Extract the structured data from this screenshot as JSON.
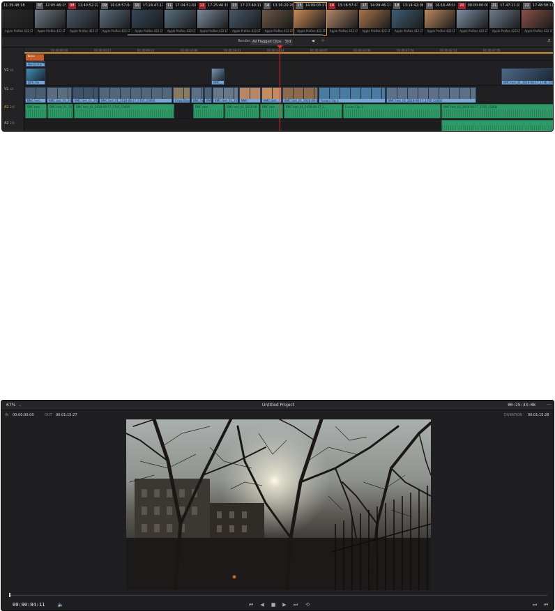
{
  "strip": {
    "clips": [
      {
        "num": "",
        "tc": "11:39:48:18",
        "cap": "Apple ProRes 422 LT",
        "color": "#2a2a2a"
      },
      {
        "num": "07",
        "tc": "12:05:46:15",
        "cap": "Apple ProRes 422 LT",
        "color": "#6e7a86"
      },
      {
        "num": "08",
        "tc": "11:40:52:22",
        "cap": "Apple ProRes 422 LT",
        "color": "#4a5868"
      },
      {
        "num": "09",
        "tc": "16:18:57:04",
        "cap": "Apple ProRes 422 LT",
        "color": "#5c6e7e"
      },
      {
        "num": "10",
        "tc": "17:24:47:17",
        "cap": "Apple ProRes 422 LT",
        "color": "#34465a"
      },
      {
        "num": "11",
        "tc": "17:24:51:02",
        "cap": "Apple ProRes 422 LT",
        "color": "#59707e"
      },
      {
        "num": "12",
        "tc": "17:25:46:19",
        "cap": "Apple ProRes 422 LT",
        "color": "#7b8c9c"
      },
      {
        "num": "13",
        "tc": "17:27:49:11",
        "cap": "Apple ProRes 422 LT",
        "color": "#475a6b"
      },
      {
        "num": "14",
        "tc": "13:16:20:20",
        "cap": "Apple ProRes 422 LT",
        "color": "#6b5745"
      },
      {
        "num": "15",
        "tc": "14:09:03:17",
        "cap": "Apple ProRes 422 LT",
        "color": "#c98a55"
      },
      {
        "num": "16",
        "tc": "13:16:57:07",
        "cap": "Apple ProRes 422 LT",
        "color": "#b2876a"
      },
      {
        "num": "17",
        "tc": "14:09:46:11",
        "cap": "Apple ProRes 422 LT",
        "color": "#a9744c"
      },
      {
        "num": "18",
        "tc": "13:14:42:06",
        "cap": "Apple ProRes 422 LT",
        "color": "#3d5f76"
      },
      {
        "num": "19",
        "tc": "16:16:48:16",
        "cap": "Apple ProRes 422 LT",
        "color": "#bd8a60"
      },
      {
        "num": "20",
        "tc": "00:00:00:00",
        "cap": "Apple ProRes 422 LT",
        "color": "#7d8fa5"
      },
      {
        "num": "21",
        "tc": "17:47:11:13",
        "cap": "Apple ProRes 422 LT",
        "color": "#6e7b8a"
      },
      {
        "num": "22",
        "tc": "17:48:58:11",
        "cap": "Apple ProRes 422 LT",
        "color": "#8a5048"
      }
    ]
  },
  "toolbar": {
    "render": "Render",
    "clips_select": "All Flagged Clips",
    "mode": "Std"
  },
  "ruler": {
    "ticks": [
      "01:00:00:00",
      "01:00:04:17",
      "01:00:09:12",
      "01:00:14:00",
      "01:00:18:21",
      "01:00:23:14",
      "01:00:28:07",
      "01:00:33:00",
      "01:00:37:16",
      "01:00:42:12",
      "01:00:47:05"
    ]
  },
  "tracks": {
    "v2": {
      "label": "V2"
    },
    "v1": {
      "label": "V1"
    },
    "a1": {
      "label": "A1",
      "level": "2.0"
    },
    "a2": {
      "label": "A2",
      "level": "2.0"
    },
    "title_clip": "Text+",
    "v2_clips": [
      {
        "label": "Horizontal Title"
      },
      {
        "label": "DPX_file"
      },
      {
        "label": "BMC_..."
      },
      {
        "label": "BMC test_01_2018-08-17_1746_C0001"
      }
    ],
    "v1_clips": [
      {
        "label": "BMC test...",
        "color": "#4a5d72"
      },
      {
        "label": "BMC test_01_2018...",
        "color": "#5a6e80"
      },
      {
        "label": "BMC test_01_201...",
        "color": "#3e5268"
      },
      {
        "label": "BMC test_01_2018-08-17_1745_C0000",
        "color": "#53677b"
      },
      {
        "label": "Cross Dissolve",
        "color": "#8a7a60"
      },
      {
        "label": "BMC test...",
        "color": "#5d6f82"
      },
      {
        "label": "BMC",
        "color": "#4e6276"
      },
      {
        "label": "BMC test_01_2018-08-...",
        "color": "#66788a"
      },
      {
        "label": "BMC",
        "color": "#b68762"
      },
      {
        "label": "BMC test...",
        "color": "#c28c5e"
      },
      {
        "label": "BMC test_01_2018-08-17_1...",
        "color": "#8e6a4c"
      },
      {
        "label": "Fusion Clip 1",
        "color": "#4a7aa0"
      },
      {
        "label": "BMC test_01_2018-08-17_1745_C0002",
        "color": "#5e7088"
      }
    ],
    "a1_clips": [
      {
        "label": "BMC test..."
      },
      {
        "label": "BMC test_01_2018..."
      },
      {
        "label": "BMC test_01_2018-08-17_1745_C0000"
      },
      {
        "label": "BMC test..."
      },
      {
        "label": "BMC test_01_2018-08..."
      },
      {
        "label": "BMC test..."
      },
      {
        "label": "BMC test_01_2018-08-17_1..."
      },
      {
        "label": "Fusion Clip 1"
      },
      {
        "label": "BMC test_01_2018-08-17_1745_C0002"
      }
    ]
  },
  "viewer": {
    "zoom": "67%",
    "title": "Untitled Project",
    "timecode_top": "00:25:33:08",
    "more": "···",
    "in_label": "IN",
    "in_value": "00:00:00:00",
    "out_label": "OUT",
    "out_value": "00:01:15:27",
    "duration_label": "DURATION",
    "duration_value": "00:01:15:28",
    "current_tc": "00:00:04:11"
  }
}
